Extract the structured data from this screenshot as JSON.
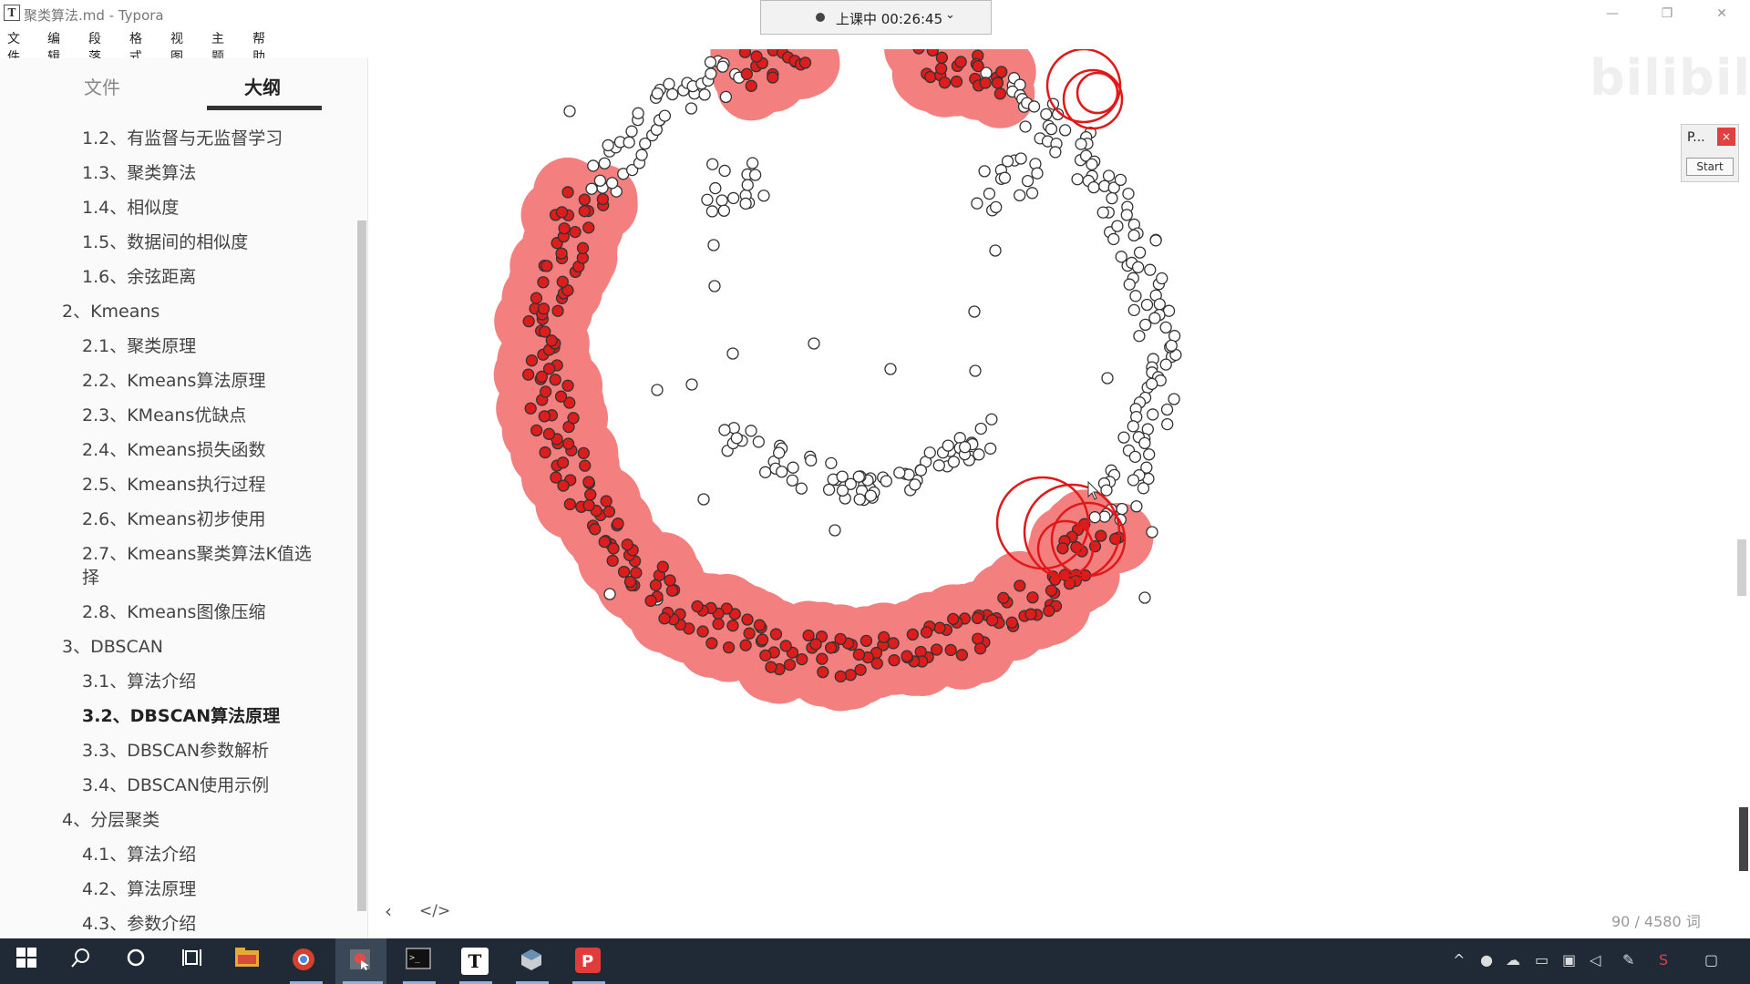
{
  "window": {
    "title": "聚类算法.md - Typora",
    "app_icon_letter": "T",
    "controls": {
      "minimize": "—",
      "restore": "❐",
      "close": "✕"
    }
  },
  "menu": [
    "文件",
    "编辑",
    "段落",
    "格式",
    "视图",
    "主题",
    "帮助"
  ],
  "class_status": {
    "label": "上课中 00:26:45",
    "chevron": "⌄"
  },
  "sidebar": {
    "tabs": [
      {
        "label": "文件",
        "active": false
      },
      {
        "label": "大纲",
        "active": true
      }
    ],
    "toc": [
      {
        "label": "1.2、有监督与无监督学习",
        "level": 2
      },
      {
        "label": "1.3、聚类算法",
        "level": 2
      },
      {
        "label": "1.4、相似度",
        "level": 2
      },
      {
        "label": "1.5、数据间的相似度",
        "level": 2
      },
      {
        "label": "1.6、余弦距离",
        "level": 2
      },
      {
        "label": "2、Kmeans",
        "level": 1
      },
      {
        "label": "2.1、聚类原理",
        "level": 2
      },
      {
        "label": "2.2、Kmeans算法原理",
        "level": 2
      },
      {
        "label": "2.3、KMeans优缺点",
        "level": 2
      },
      {
        "label": "2.4、Kmeans损失函数",
        "level": 2
      },
      {
        "label": "2.5、Kmeans执行过程",
        "level": 2
      },
      {
        "label": "2.6、Kmeans初步使用",
        "level": 2
      },
      {
        "label": "2.7、Kmeans聚类算法K值选",
        "cont": "择",
        "level": 2
      },
      {
        "label": "2.8、Kmeans图像压缩",
        "level": 2
      },
      {
        "label": "3、DBSCAN",
        "level": 1
      },
      {
        "label": "3.1、算法介绍",
        "level": 2
      },
      {
        "label": "3.2、DBSCAN算法原理",
        "level": 2,
        "active": true
      },
      {
        "label": "3.3、DBSCAN参数解析",
        "level": 2
      },
      {
        "label": "3.4、DBSCAN使用示例",
        "level": 2
      },
      {
        "label": "4、分层聚类",
        "level": 1
      },
      {
        "label": "4.1、算法介绍",
        "level": 2
      },
      {
        "label": "4.2、算法原理",
        "level": 2
      },
      {
        "label": "4.3、参数介绍",
        "level": 2
      }
    ]
  },
  "editor": {
    "nav_prev": "‹",
    "source_toggle": "</>",
    "word_count": "90 / 4580 词",
    "watermark": "bilibili",
    "widget": {
      "title": "P...",
      "close": "×",
      "start": "Start"
    }
  },
  "colors": {
    "cluster_fill": "#f47f7f",
    "core_point": "#dd1c1c",
    "eps_circle": "#e01818",
    "taskbar": "#1f2a36"
  },
  "taskbar": {
    "icons": [
      "windows-start-icon",
      "search-icon",
      "cortana-icon",
      "task-view-icon",
      "file-explorer-icon",
      "chrome-icon",
      "screen-capture-icon",
      "terminal-icon",
      "typora-icon",
      "app-cube-icon",
      "wps-pdf-icon"
    ],
    "typora_letter": "T"
  }
}
